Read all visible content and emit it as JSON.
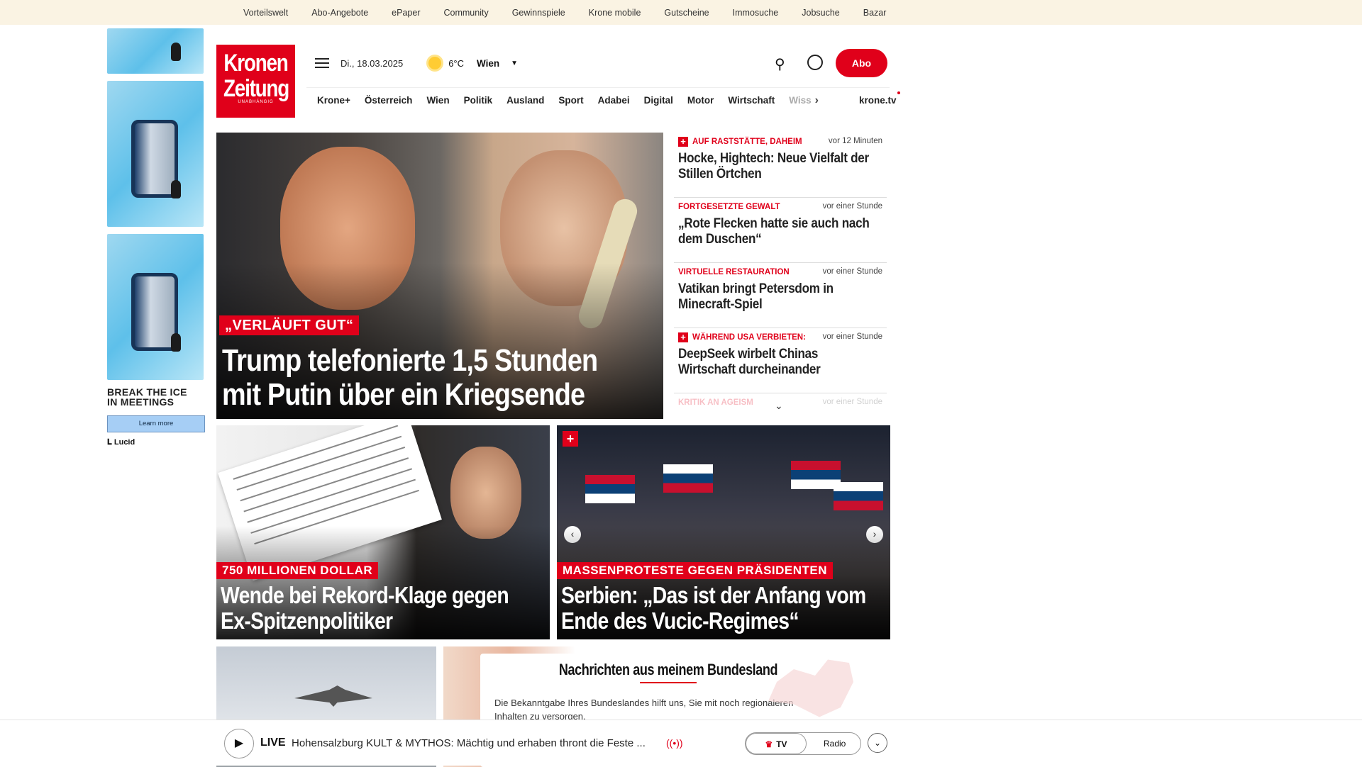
{
  "topbar": [
    "Vorteilswelt",
    "Abo-Angebote",
    "ePaper",
    "Community",
    "Gewinnspiele",
    "Krone mobile",
    "Gutscheine",
    "Immosuche",
    "Jobsuche",
    "Bazar"
  ],
  "ad": {
    "headline_1": "BREAK THE ICE",
    "headline_2": "IN MEETINGS",
    "cta": "Learn more",
    "brand": "Lucid",
    "close": "▷✕"
  },
  "logo": {
    "line1": "Kronen",
    "line2": "Zeitung",
    "tagline": "UNABHÄNGIG"
  },
  "header": {
    "date": "Di., 18.03.2025",
    "temperature": "6°C",
    "city": "Wien",
    "abo": "Abo"
  },
  "nav": {
    "items": [
      "Krone+",
      "Österreich",
      "Wien",
      "Politik",
      "Ausland",
      "Sport",
      "Adabei",
      "Digital",
      "Motor",
      "Wirtschaft"
    ],
    "faded": "Wiss",
    "tv": "krone.tv"
  },
  "hero": {
    "kicker": "„VERLÄUFT GUT“",
    "title": "Trump telefonierte 1,5 Stunden mit Putin über ein Kriegsende"
  },
  "list": [
    {
      "plus": true,
      "category": "AUF RASTSTÄTTE, DAHEIM",
      "time": "vor 12 Minuten",
      "title": "Hocke, Hightech: Neue Vielfalt der Stillen Örtchen"
    },
    {
      "plus": false,
      "category": "FORTGESETZTE GEWALT",
      "time": "vor einer Stunde",
      "title": "„Rote Flecken hatte sie auch nach dem Duschen“"
    },
    {
      "plus": false,
      "category": "VIRTUELLE RESTAURATION",
      "time": "vor einer Stunde",
      "title": "Vatikan bringt Petersdom in Minecraft-Spiel"
    },
    {
      "plus": true,
      "category": "WÄHREND USA VERBIETEN:",
      "time": "vor einer Stunde",
      "title": "DeepSeek wirbelt Chinas Wirtschaft durcheinander"
    },
    {
      "plus": false,
      "category": "KRITIK AN AGEISM",
      "time": "vor einer Stunde",
      "title": ""
    }
  ],
  "cards": [
    {
      "kicker": "750 MILLIONEN DOLLAR",
      "title": "Wende bei Rekord-Klage gegen Ex-Spitzenpolitiker"
    },
    {
      "kicker": "MASSENPROTESTE GEGEN PRÄSIDENTEN",
      "title": "Serbien: „Das ist der Anfang vom Ende des Vucic-Regimes“"
    }
  ],
  "bundesland": {
    "title": "Nachrichten aus meinem Bundesland",
    "text": "Die Bekanntgabe Ihres Bundeslandes hilft uns, Sie mit noch regionaleren Inhalten zu versorgen."
  },
  "live": {
    "label": "LIVE",
    "text": "Hohensalzburg KULT & MYTHOS: Mächtig und erhaben thront die Feste ...",
    "tv": "TV",
    "radio": "Radio"
  },
  "colors": {
    "brand": "#e0001a",
    "topbar": "#faf3e3"
  }
}
